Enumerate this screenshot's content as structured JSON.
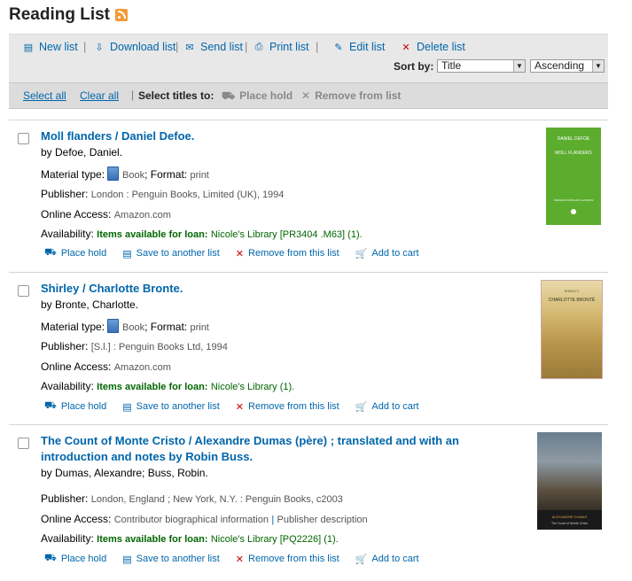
{
  "page": {
    "title": "Reading List"
  },
  "toolbar": {
    "new_list": "New list",
    "download_list": "Download list",
    "send_list": "Send list",
    "print_list": "Print list",
    "edit_list": "Edit list",
    "delete_list": "Delete list",
    "sort_by_label": "Sort by:",
    "sort_field": "Title",
    "sort_order": "Ascending"
  },
  "selection_bar": {
    "select_all": "Select all",
    "clear_all": "Clear all",
    "select_titles_to": "Select titles to:",
    "place_hold": "Place hold",
    "remove_from_list": "Remove from list"
  },
  "labels": {
    "material_type": "Material type:",
    "format": "Format:",
    "publisher": "Publisher:",
    "online_access": "Online Access:",
    "availability": "Availability:",
    "items_available": "Items available for loan:"
  },
  "actions": {
    "place_hold": "Place hold",
    "save_to_another_list": "Save to another list",
    "remove_from_this_list": "Remove from this list",
    "add_to_cart": "Add to cart"
  },
  "records": [
    {
      "title": "Moll flanders / Daniel Defoe.",
      "author": "by Defoe, Daniel.",
      "material_type": "Book",
      "format": "print",
      "publisher": "London : Penguin Books, Limited (UK), 1994",
      "online_access": "Amazon.com",
      "availability_location": "Nicole's Library [PR3404 .M63] (1).",
      "cover": {
        "top_text": "DANIEL DEFOE",
        "main_text": "MOLL FLANDERS",
        "bottom_text": "PENGUIN POPULAR CLASSICS"
      }
    },
    {
      "title": "Shirley / Charlotte Bronte.",
      "author": "by Bronte, Charlotte.",
      "material_type": "Book",
      "format": "print",
      "publisher": "[S.l.] : Penguin Books Ltd, 1994",
      "online_access": "Amazon.com",
      "availability_location": "Nicole's Library (1).",
      "cover": {
        "top_text": "SHIRLEY",
        "main_text": "CHARLOTTE BRONTË"
      }
    },
    {
      "title": "The Count of Monte Cristo / Alexandre Dumas (père) ; translated and with an introduction and notes by Robin Buss.",
      "author": "by Dumas, Alexandre; Buss, Robin.",
      "publisher": "London, England ; New York, N.Y. : Penguin Books, c2003",
      "online_access_1": "Contributor biographical information",
      "online_access_2": "Publisher description",
      "availability_location": "Nicole's Library [PQ2226] (1).",
      "cover": {
        "main_text": "ALEXANDRE DUMAS",
        "sub_text": "The Count of Monte Cristo"
      }
    }
  ],
  "colors": {
    "link": "#0066aa",
    "available": "#006600",
    "remove": "#cc0000",
    "rss": "#f39a34"
  }
}
